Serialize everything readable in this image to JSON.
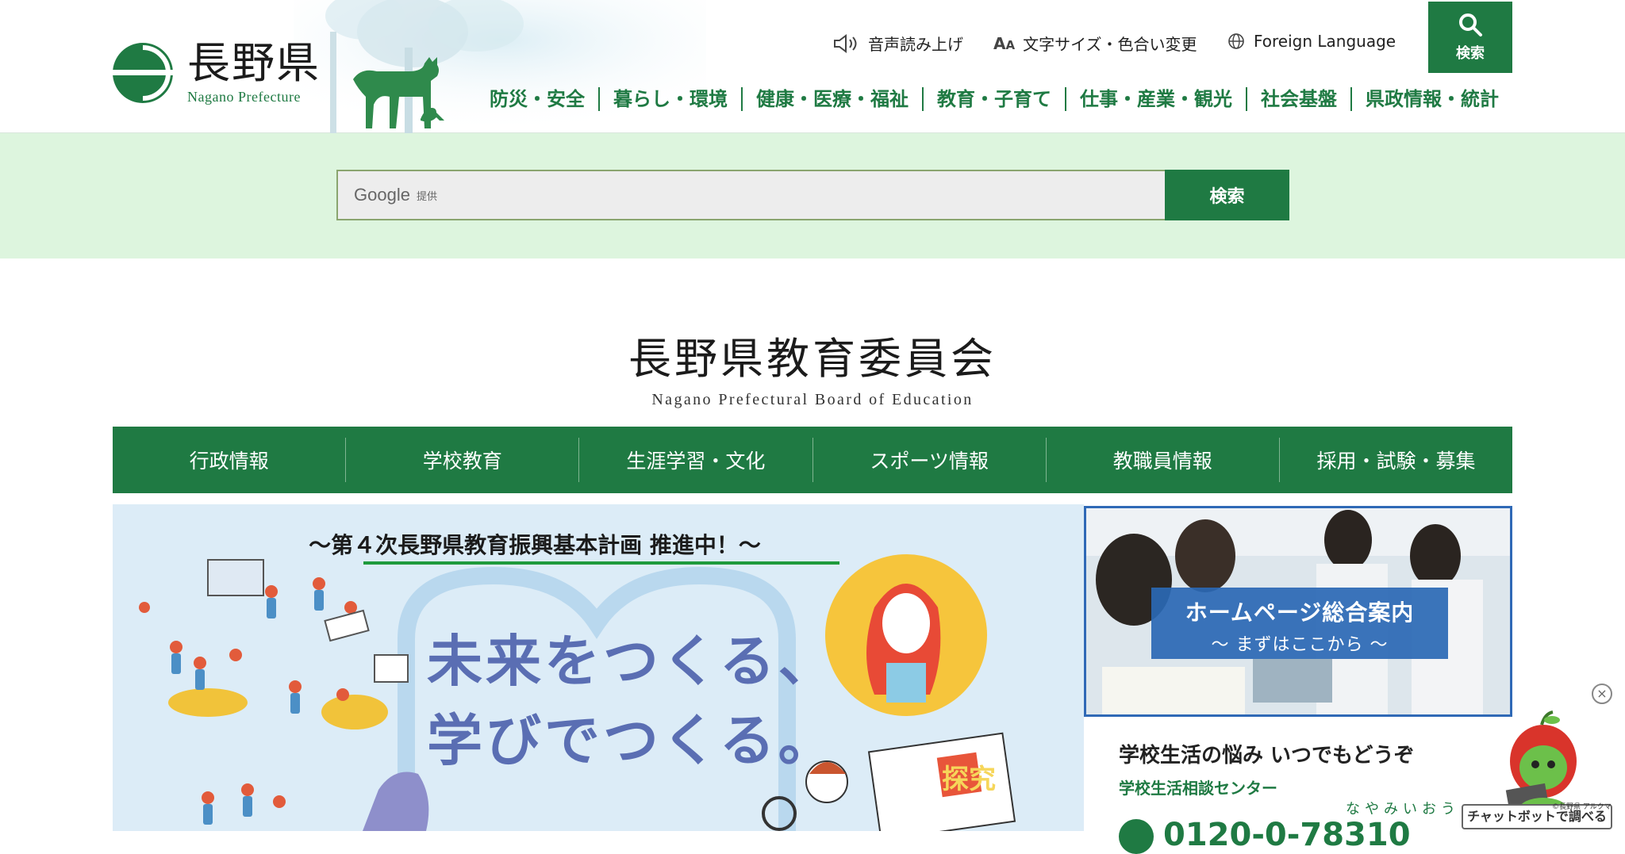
{
  "header": {
    "logo_jp": "長野県",
    "logo_en": "Nagano Prefecture",
    "utilities": {
      "speech": "音声読み上げ",
      "text_size": "文字サイズ・色合い変更",
      "language": "Foreign Language"
    },
    "search_button": "検索",
    "global_nav": [
      "防災・安全",
      "暮らし・環境",
      "健康・医療・福祉",
      "教育・子育て",
      "仕事・産業・観光",
      "社会基盤",
      "県政情報・統計"
    ]
  },
  "search": {
    "google": "Google",
    "provided": "提供",
    "submit": "検索"
  },
  "board": {
    "title_jp": "長野県教育委員会",
    "title_en": "Nagano Prefectural Board of Education"
  },
  "subnav": [
    "行政情報",
    "学校教育",
    "生涯学習・文化",
    "スポーツ情報",
    "教職員情報",
    "採用・試験・募集"
  ],
  "banner": {
    "headline": "〜第４次長野県教育振興基本計画 推進中！〜",
    "slogan_line1": "未来をつくる、",
    "slogan_line2": "学びでつくる。",
    "tankyu": "探究"
  },
  "guide_card": {
    "title": "ホームページ総合案内",
    "subtitle": "〜 まずはここから 〜"
  },
  "consult_card": {
    "title": "学校生活の悩み いつでもどうぞ",
    "center": "学校生活相談センター",
    "kana": "なやみいおう",
    "phone": "0120-0-78310"
  },
  "chatbot": {
    "label": "チャットボットで調べる",
    "copyright": "©長野県 アルクマ",
    "close": "×"
  },
  "colors": {
    "brand_green": "#1f7a43",
    "search_band": "#ddf5de",
    "banner_bg": "#dcecf7",
    "guide_blue": "#2f69b6"
  }
}
